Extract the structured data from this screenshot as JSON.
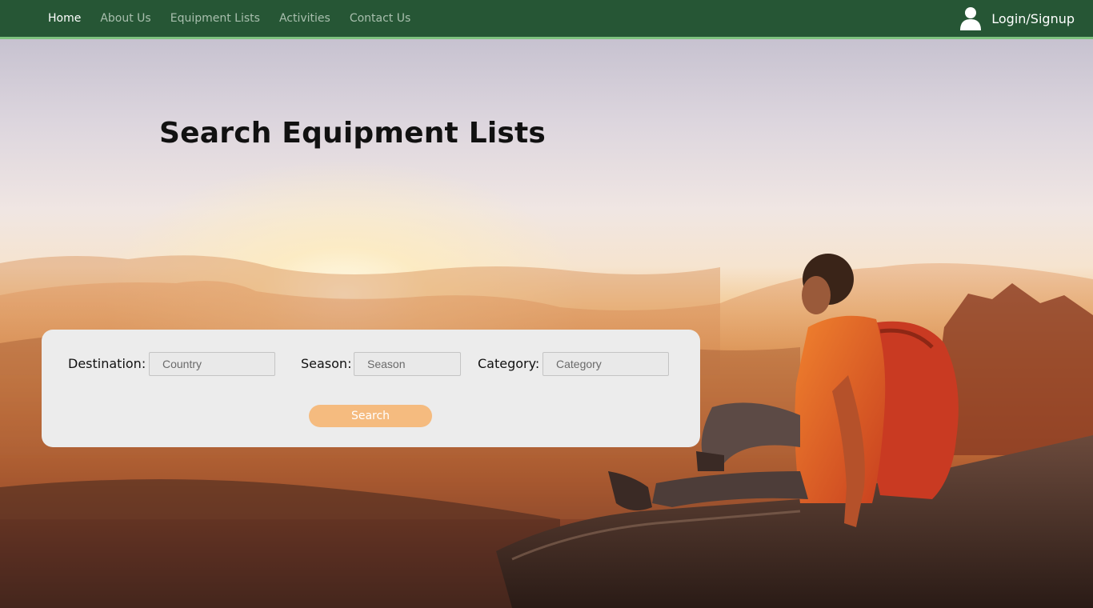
{
  "nav": {
    "links": [
      "Home",
      "About Us",
      "Equipment Lists",
      "Activities",
      "Contact Us"
    ],
    "login_label": "Login/Signup"
  },
  "hero": {
    "title": "Search Equipment Lists"
  },
  "search": {
    "destination_label": "Destination:",
    "destination_placeholder": "Country",
    "season_label": "Season:",
    "season_placeholder": "Season",
    "category_label": "Category:",
    "category_placeholder": "Category",
    "button_label": "Search"
  },
  "colors": {
    "nav_bg": "#265635",
    "nav_accent": "#7ec27f",
    "button": "#f5bb7f",
    "panel": "#ececec"
  },
  "icons": {
    "user": "user-icon"
  }
}
